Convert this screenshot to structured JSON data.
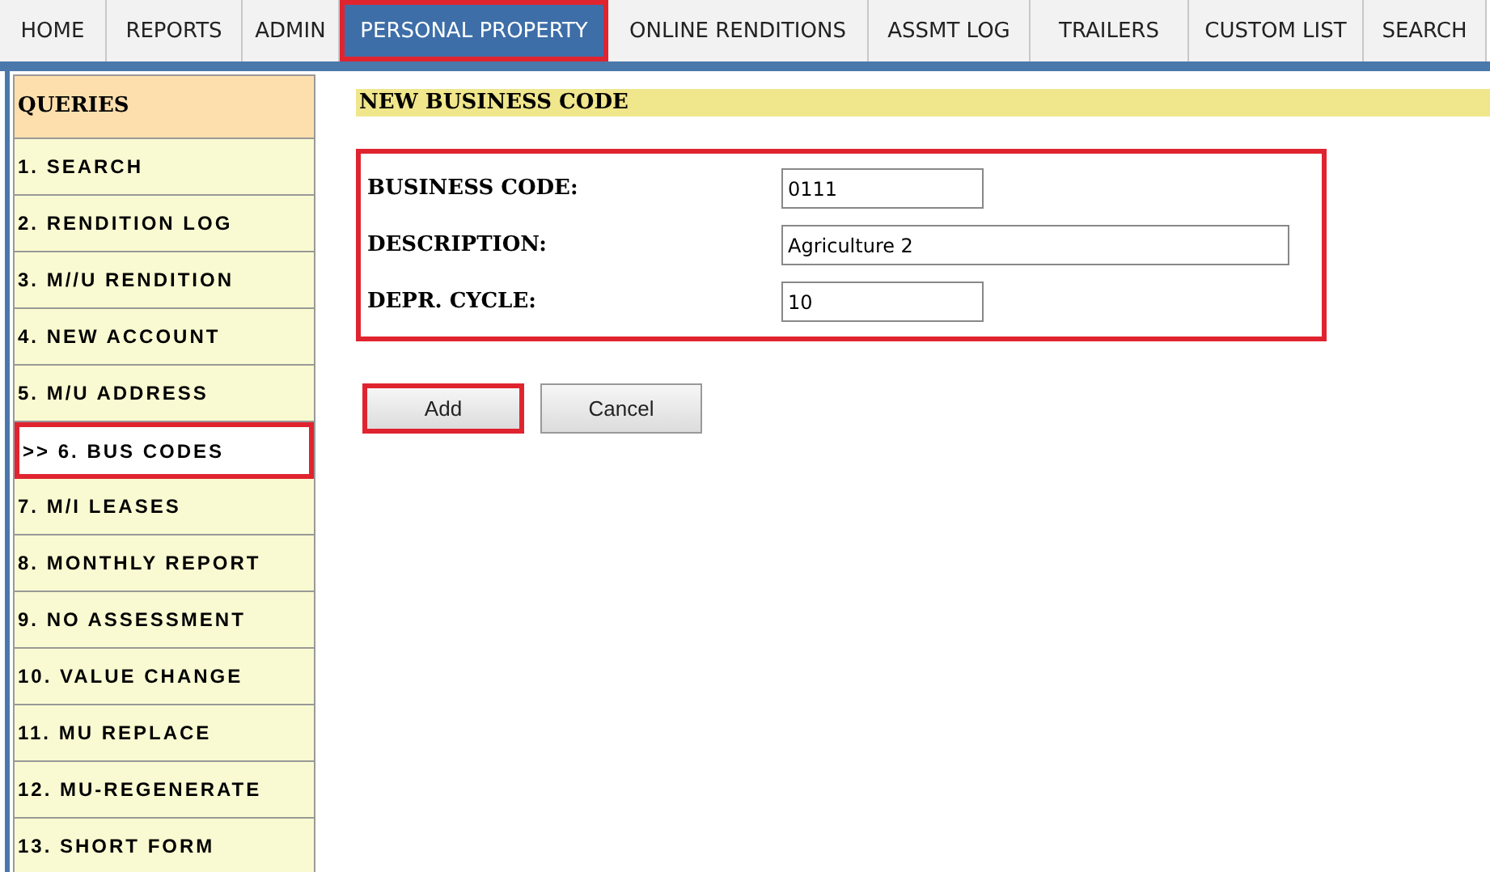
{
  "nav_tabs": [
    {
      "label": "HOME",
      "selected": false
    },
    {
      "label": "REPORTS",
      "selected": false
    },
    {
      "label": "ADMIN",
      "selected": false
    },
    {
      "label": "PERSONAL PROPERTY",
      "selected": true
    },
    {
      "label": "ONLINE RENDITIONS",
      "selected": false
    },
    {
      "label": "ASSMT LOG",
      "selected": false
    },
    {
      "label": "TRAILERS",
      "selected": false
    },
    {
      "label": "CUSTOM LIST",
      "selected": false
    },
    {
      "label": "SEARCH",
      "selected": false
    }
  ],
  "sidebar": {
    "title": "QUERIES",
    "items": [
      {
        "label": "1. SEARCH",
        "selected": false
      },
      {
        "label": "2. RENDITION LOG",
        "selected": false
      },
      {
        "label": "3. M//U RENDITION",
        "selected": false
      },
      {
        "label": "4. NEW ACCOUNT",
        "selected": false
      },
      {
        "label": "5. M/U ADDRESS",
        "selected": false
      },
      {
        "label": ">> 6. BUS CODES",
        "selected": true
      },
      {
        "label": "7. M/I LEASES",
        "selected": false
      },
      {
        "label": "8. MONTHLY REPORT",
        "selected": false
      },
      {
        "label": "9. NO ASSESSMENT",
        "selected": false
      },
      {
        "label": "10. VALUE CHANGE",
        "selected": false
      },
      {
        "label": "11. MU REPLACE",
        "selected": false
      },
      {
        "label": "12. MU-REGENERATE",
        "selected": false
      },
      {
        "label": "13. SHORT FORM",
        "selected": false
      }
    ]
  },
  "form": {
    "title": "NEW BUSINESS CODE",
    "highlighted": true,
    "fields": [
      {
        "label": "BUSINESS CODE:",
        "value": "0111",
        "kind": "short"
      },
      {
        "label": "DESCRIPTION:",
        "value": "Agriculture 2",
        "kind": "long"
      },
      {
        "label": "DEPR. CYCLE:",
        "value": "10",
        "kind": "short"
      }
    ]
  },
  "buttons": [
    {
      "label": "Add",
      "highlighted": true
    },
    {
      "label": "Cancel",
      "highlighted": false
    }
  ]
}
